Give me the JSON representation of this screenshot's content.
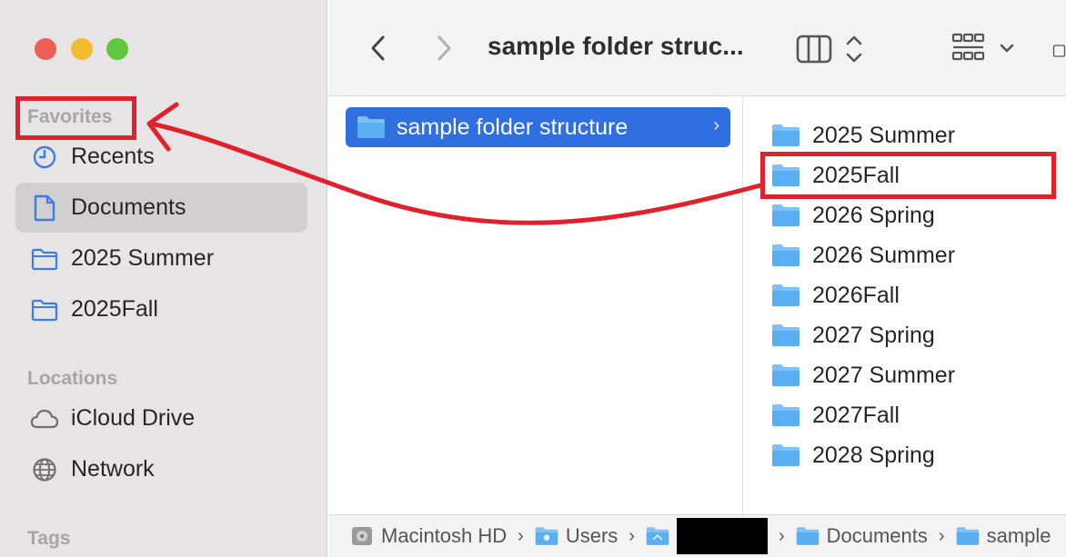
{
  "window": {
    "title": "sample folder struc..."
  },
  "sidebar": {
    "favorites_heading": "Favorites",
    "favorites": [
      {
        "label": "Recents",
        "icon": "clock-icon"
      },
      {
        "label": "Documents",
        "icon": "document-icon",
        "selected": true
      },
      {
        "label": "2025 Summer",
        "icon": "folder-icon"
      },
      {
        "label": "2025Fall",
        "icon": "folder-icon"
      }
    ],
    "locations_heading": "Locations",
    "locations": [
      {
        "label": "iCloud Drive",
        "icon": "cloud-icon"
      },
      {
        "label": "Network",
        "icon": "globe-icon"
      }
    ],
    "tags_heading": "Tags"
  },
  "column1": {
    "selected_item": "sample folder structure"
  },
  "column2": {
    "items": [
      "2025 Summer",
      "2025Fall",
      "2026 Spring",
      "2026 Summer",
      "2026Fall",
      "2027 Spring",
      "2027 Summer",
      "2027Fall",
      "2028 Spring"
    ]
  },
  "pathbar": {
    "crumbs": [
      "Macintosh HD",
      "Users",
      "Documents",
      "sample"
    ]
  },
  "colors": {
    "selection_blue": "#2f6fe0",
    "annotation_red": "#e0202a",
    "folder_blue": "#5aaef2"
  }
}
